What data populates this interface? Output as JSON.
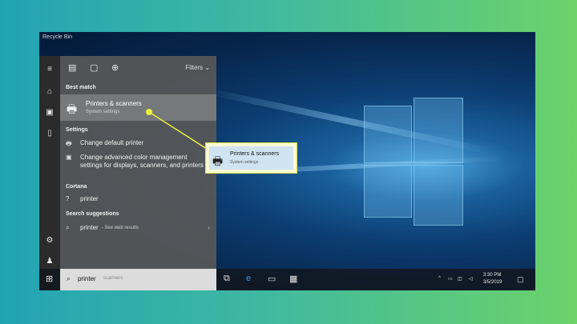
{
  "desktop": {
    "recycle_bin": "Recycle Bin"
  },
  "start_menu": {
    "filters_label": "Filters",
    "best_match_header": "Best match",
    "best_match_title": "Printers & scanners",
    "best_match_subtitle": "System settings",
    "settings_header": "Settings",
    "settings_items": [
      "Change default printer",
      "Change advanced color management settings for displays, scanners, and printers"
    ],
    "cortana_header": "Cortana",
    "cortana_item": "printer",
    "suggestions_header": "Search suggestions",
    "suggestion_item": "printer",
    "suggestion_hint": "- See web results"
  },
  "search": {
    "query": "printer",
    "placeholder": "scanners"
  },
  "callout": {
    "title": "Printers & scanners",
    "subtitle": "System settings"
  },
  "taskbar": {
    "time": "3:30 PM",
    "date": "3/5/2019"
  },
  "colors": {
    "accent": "#e9ef3d",
    "background_start": "#22a3b4",
    "background_end": "#6cd36a"
  }
}
